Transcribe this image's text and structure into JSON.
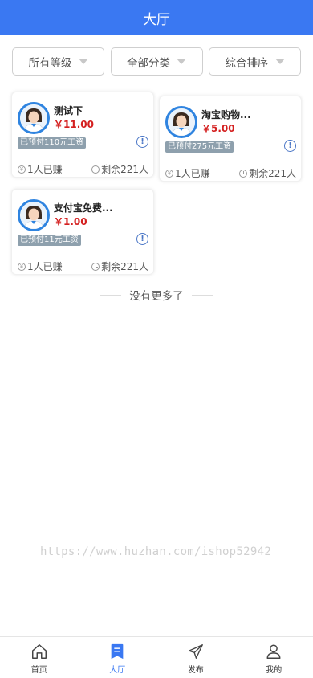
{
  "header": {
    "title": "大厅"
  },
  "filters": [
    {
      "label": "所有等级"
    },
    {
      "label": "全部分类"
    },
    {
      "label": "综合排序"
    }
  ],
  "tasks": [
    {
      "title": "测试下",
      "price": "￥11.00",
      "badge": "已预付110元工资",
      "earned": "1人已赚",
      "remaining": "剩余221人"
    },
    {
      "title": "淘宝购物...",
      "price": "￥5.00",
      "badge": "已预付275元工资",
      "earned": "1人已赚",
      "remaining": "剩余221人"
    },
    {
      "title": "支付宝免费...",
      "price": "￥1.00",
      "badge": "已预付11元工资",
      "earned": "1人已赚",
      "remaining": "剩余221人"
    }
  ],
  "no_more": "没有更多了",
  "watermark": "https://www.huzhan.com/ishop52942",
  "tabbar": [
    {
      "label": "首页",
      "icon": "home-icon"
    },
    {
      "label": "大厅",
      "icon": "hall-icon",
      "active": true
    },
    {
      "label": "发布",
      "icon": "send-icon"
    },
    {
      "label": "我的",
      "icon": "user-icon"
    }
  ],
  "colors": {
    "accent": "#3a78f2",
    "price": "#d42020",
    "badge": "#8ea0ad"
  }
}
